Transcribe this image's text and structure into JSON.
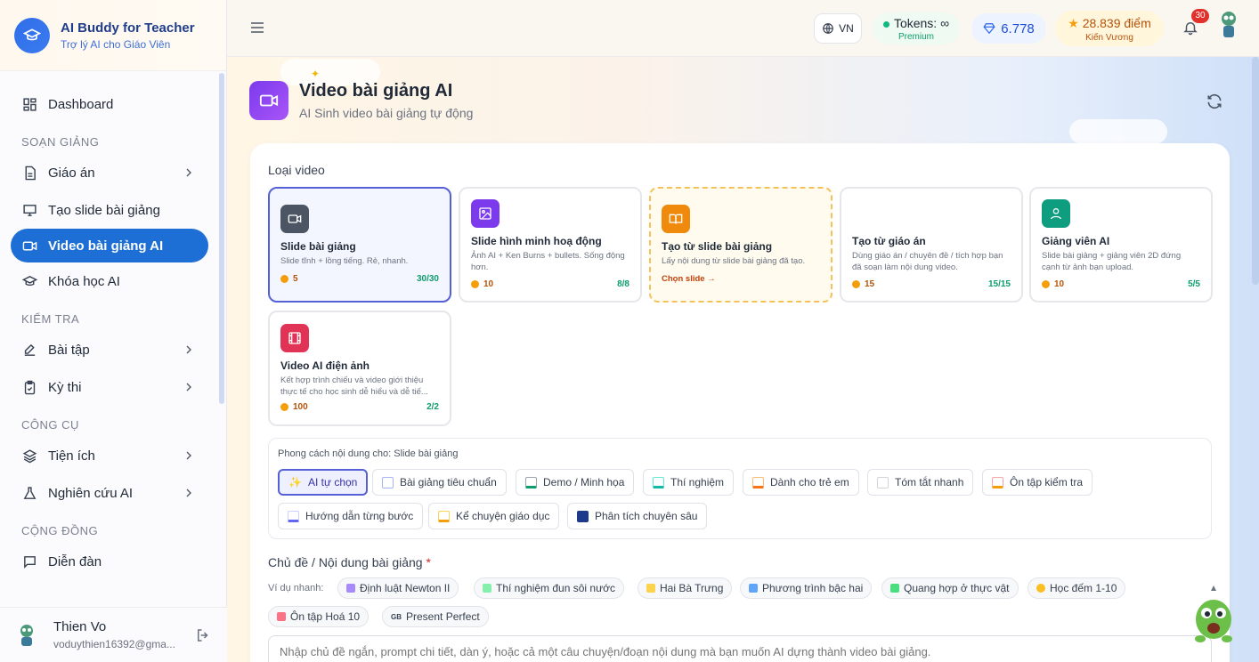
{
  "brand": {
    "title": "AI Buddy for Teacher",
    "subtitle": "Trợ lý AI cho Giáo Viên"
  },
  "sidebar": {
    "dashboard": "Dashboard",
    "sec_soan_giang": "SOẠN GIẢNG",
    "giao_an": "Giáo án",
    "tao_slide": "Tạo slide bài giảng",
    "video_ai": "Video bài giảng AI",
    "khoa_hoc": "Khóa học AI",
    "sec_kiem_tra": "KIỂM TRA",
    "bai_tap": "Bài tập",
    "ky_thi": "Kỳ thi",
    "sec_cong_cu": "CÔNG CỤ",
    "tien_ich": "Tiện ích",
    "nghien_cuu": "Nghiên cứu AI",
    "sec_cong_dong": "CỘNG ĐỒNG",
    "dien_dan": "Diễn đàn"
  },
  "user": {
    "name": "Thien Vo",
    "email": "voduythien16392@gma..."
  },
  "topbar": {
    "lang": "VN",
    "tokens_label": "Tokens: ∞",
    "tokens_tier": "Premium",
    "gems": "6.778",
    "points": "28.839 điểm",
    "points_rank": "Kiến Vương",
    "notifications": "30"
  },
  "page": {
    "title": "Video bài giảng AI",
    "subtitle": "AI Sinh video bài giảng tự động"
  },
  "video_types": {
    "label": "Loại video",
    "items": [
      {
        "name": "Slide bài giảng",
        "desc": "Slide tĩnh + lồng tiếng. Rẻ, nhanh.",
        "cost": "5",
        "quota": "30/30"
      },
      {
        "name": "Slide hình minh hoạ động",
        "desc": "Ảnh AI + Ken Burns + bullets. Sống động hơn.",
        "cost": "10",
        "quota": "8/8"
      },
      {
        "name": "Tạo từ slide bài giảng",
        "desc": "Lấy nội dung từ slide bài giảng đã tạo.",
        "link": "Chọn slide →"
      },
      {
        "name": "Tạo từ giáo án",
        "desc": "Dùng giáo án / chuyên đề / tích hợp bạn đã soạn làm nội dung video.",
        "cost": "15",
        "quota": "15/15"
      },
      {
        "name": "Giảng viên AI",
        "desc": "Slide bài giảng + giảng viên 2D đứng cạnh từ ảnh bạn upload.",
        "cost": "10",
        "quota": "5/5"
      },
      {
        "name": "Video AI điện ảnh",
        "desc": "Kết hợp trình chiếu và video giới thiệu thực tế cho học sinh dễ hiểu và dễ tiế...",
        "cost": "100",
        "quota": "2/2"
      }
    ]
  },
  "styles": {
    "label": "Phong cách nội dung cho: Slide bài giảng",
    "items": [
      "AI tự chọn",
      "Bài giảng tiêu chuẩn",
      "Demo / Minh họa",
      "Thí nghiệm",
      "Dành cho trẻ em",
      "Tóm tắt nhanh",
      "Ôn tập kiểm tra",
      "Hướng dẫn từng bước",
      "Kể chuyện giáo dục",
      "Phân tích chuyên sâu"
    ]
  },
  "topic": {
    "label": "Chủ đề / Nội dung bài giảng",
    "required": "*",
    "quick_label": "Ví dụ nhanh:",
    "examples": [
      "Định luật Newton II",
      "Thí nghiệm đun sôi nước",
      "Hai Bà Trưng",
      "Phương trình bậc hai",
      "Quang hợp ở thực vật",
      "Học đếm 1-10",
      "Ôn tập Hoá 10",
      "Present Perfect"
    ],
    "example_prefix_gb": "GB",
    "placeholder": "Nhập chủ đề ngắn, prompt chi tiết, dàn ý, hoặc cả một câu chuyện/đoạn nội dung mà bạn muốn AI dựng thành video bài giảng."
  },
  "colors": {
    "primary": "#1d6fd6",
    "accent": "#5560d6"
  }
}
